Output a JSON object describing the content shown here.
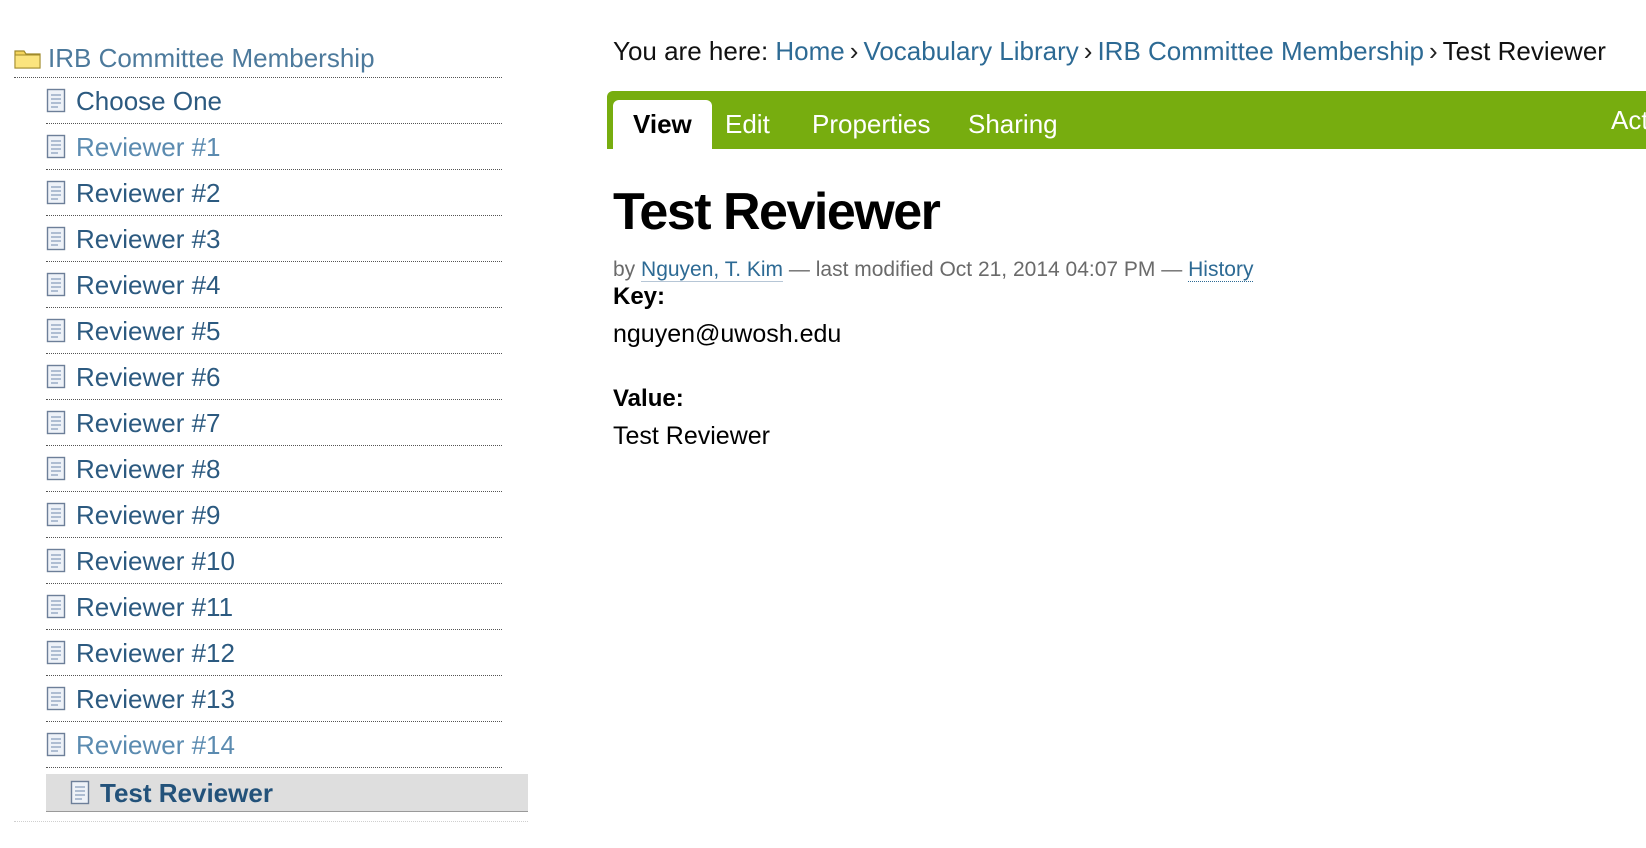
{
  "sidebar": {
    "root_label": "IRB Committee Membership",
    "items": [
      {
        "label": "Choose One",
        "tone": "dark"
      },
      {
        "label": "Reviewer #1",
        "tone": "light"
      },
      {
        "label": "Reviewer #2",
        "tone": "dark"
      },
      {
        "label": "Reviewer #3",
        "tone": "dark"
      },
      {
        "label": "Reviewer #4",
        "tone": "dark"
      },
      {
        "label": "Reviewer #5",
        "tone": "dark"
      },
      {
        "label": "Reviewer #6",
        "tone": "dark"
      },
      {
        "label": "Reviewer #7",
        "tone": "dark"
      },
      {
        "label": "Reviewer #8",
        "tone": "dark"
      },
      {
        "label": "Reviewer #9",
        "tone": "dark"
      },
      {
        "label": "Reviewer #10",
        "tone": "dark"
      },
      {
        "label": "Reviewer #11",
        "tone": "dark"
      },
      {
        "label": "Reviewer #12",
        "tone": "dark"
      },
      {
        "label": "Reviewer #13",
        "tone": "dark"
      },
      {
        "label": "Reviewer #14",
        "tone": "light"
      }
    ],
    "current_item": "Test Reviewer"
  },
  "breadcrumb": {
    "prefix": "You are here:",
    "links": [
      "Home",
      "Vocabulary Library",
      "IRB Committee Membership"
    ],
    "separator": "›",
    "current": "Test Reviewer"
  },
  "tabs": {
    "items": [
      {
        "label": "View",
        "active": true
      },
      {
        "label": "Edit",
        "active": false
      },
      {
        "label": "Properties",
        "active": false
      },
      {
        "label": "Sharing",
        "active": false
      }
    ],
    "actions_label": "Act"
  },
  "document": {
    "title": "Test Reviewer",
    "byline": {
      "by": "by",
      "author": "Nguyen, T. Kim",
      "modified_text": "— last modified Oct 21, 2014 04:07 PM —",
      "history": "History"
    },
    "key_label": "Key:",
    "key_value": "nguyen@uwosh.edu",
    "value_label": "Value:",
    "value_value": "Test Reviewer"
  },
  "colors": {
    "tab_bar": "#77ad0f",
    "link": "#2d6a94",
    "nav_link_dark": "#2c5a80",
    "nav_link_light": "#5b8bb0"
  },
  "icons": {
    "root": "folder-icon",
    "item": "document-icon"
  }
}
